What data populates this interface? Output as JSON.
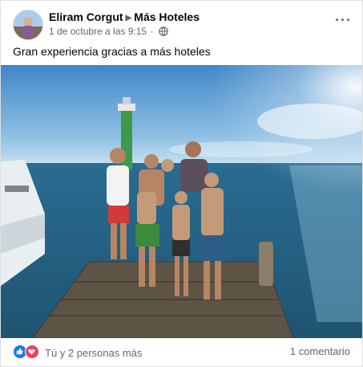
{
  "post": {
    "author": "Eliram Corgut",
    "page": "Más Hoteles",
    "timestamp": "1 de octubre a las 9:15",
    "separator": "·",
    "privacy_icon": "globe-icon",
    "more_label": "···",
    "text": "Gran experiencia gracias a más hoteles"
  },
  "footer": {
    "reaction_icons": [
      "like-icon",
      "love-icon"
    ],
    "reactions_text": "Tú y 2 personas más",
    "comments_text": "1 comentario"
  },
  "colors": {
    "like": "#1877f2",
    "love": "#f33e58",
    "secondary_text": "#65676b",
    "primary_text": "#050505"
  }
}
